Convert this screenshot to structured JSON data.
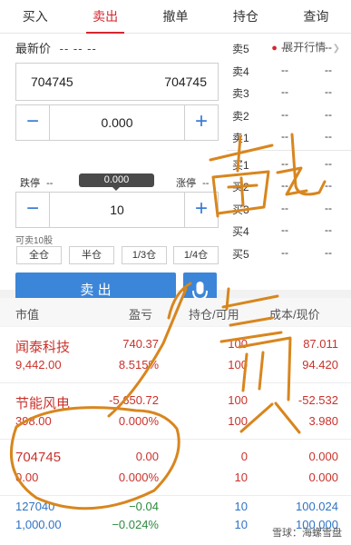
{
  "tabs": [
    "买入",
    "卖出",
    "撤单",
    "持仓",
    "查询"
  ],
  "order": {
    "latest_label": "最新价",
    "latest_value": "-- -- --",
    "expand_label": "展开行情",
    "code_left": "704745",
    "code_right": "704745",
    "price_value": "0.000",
    "limit_down_label": "跌停",
    "limit_down_value": "--",
    "tooltip_value": "0.000",
    "limit_up_label": "涨停",
    "limit_up_value": "--",
    "qty_value": "10",
    "sellable_text": "可卖10股",
    "position_buttons": [
      "全仓",
      "半仓",
      "1/3仓",
      "1/4仓"
    ],
    "sell_label": "卖 出"
  },
  "quotes": [
    {
      "name": "卖5",
      "price": "--",
      "vol": "--"
    },
    {
      "name": "卖4",
      "price": "--",
      "vol": "--"
    },
    {
      "name": "卖3",
      "price": "--",
      "vol": "--"
    },
    {
      "name": "卖2",
      "price": "--",
      "vol": "--"
    },
    {
      "name": "卖1",
      "price": "--",
      "vol": "--"
    },
    {
      "name": "买1",
      "price": "--",
      "vol": "--"
    },
    {
      "name": "买2",
      "price": "--",
      "vol": "--"
    },
    {
      "name": "买3",
      "price": "--",
      "vol": "--"
    },
    {
      "name": "买4",
      "price": "--",
      "vol": "--"
    },
    {
      "name": "买5",
      "price": "--",
      "vol": "--"
    }
  ],
  "holdings_header": [
    "市值",
    "盈亏",
    "持仓/可用",
    "成本/现价"
  ],
  "holdings": [
    {
      "name": "闻泰科技",
      "value": "9,442.00",
      "pl": "740.37",
      "pl_pct": "8.515%",
      "pos": "100",
      "avail": "100",
      "cost": "87.011",
      "price": "94.420"
    },
    {
      "name": "节能风电",
      "value": "398.00",
      "pl": "-5,650.72",
      "pl_pct": "0.000%",
      "pos": "100",
      "avail": "100",
      "cost": "-52.532",
      "price": "3.980"
    },
    {
      "name": "704745",
      "value": "0.00",
      "pl": "0.00",
      "pl_pct": "0.000%",
      "pos": "0",
      "avail": "10",
      "cost": "0.000",
      "price": "0.000"
    },
    {
      "name": "127040",
      "value": "1,000.00",
      "pl": "−0.04",
      "pl_pct": "−0.024%",
      "pos": "10",
      "avail": "10",
      "cost": "100.024",
      "price": "100.000"
    }
  ],
  "watermark": "雪球：海螺雪盘",
  "colors": {
    "accent": "#d6262e",
    "button": "#3b86d8",
    "ink": "#d8861e"
  }
}
